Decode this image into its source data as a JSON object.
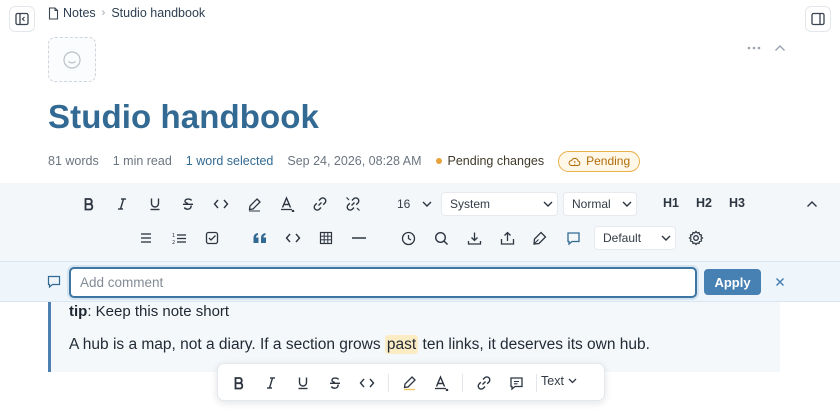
{
  "breadcrumb": {
    "notes": "Notes",
    "current": "Studio handbook"
  },
  "page": {
    "title": "Studio handbook"
  },
  "meta": {
    "word_count": "81 words",
    "read_time": "1 min read",
    "selection": "1 word selected",
    "timestamp": "Sep 24, 2026, 08:28 AM",
    "pending_changes": "Pending changes",
    "pending_badge": "Pending"
  },
  "toolbar": {
    "font_size": "16",
    "font_family": "System",
    "paragraph_style": "Normal",
    "h1": "H1",
    "h2": "H2",
    "h3": "H3",
    "theme": "Default"
  },
  "comment": {
    "placeholder": "Add comment",
    "value": "",
    "apply_label": "Apply"
  },
  "content": {
    "tip_label": "tip",
    "tip_text": ": Keep this note short",
    "para_before": "A hub is a map, not a diary. If a section grows ",
    "para_highlight": "past",
    "para_after": " ten links, it deserves its own hub."
  },
  "bubble": {
    "text_dropdown": "Text"
  },
  "colors": {
    "accent": "#336a93",
    "pending": "#e8a23a",
    "apply": "#4780b2"
  }
}
